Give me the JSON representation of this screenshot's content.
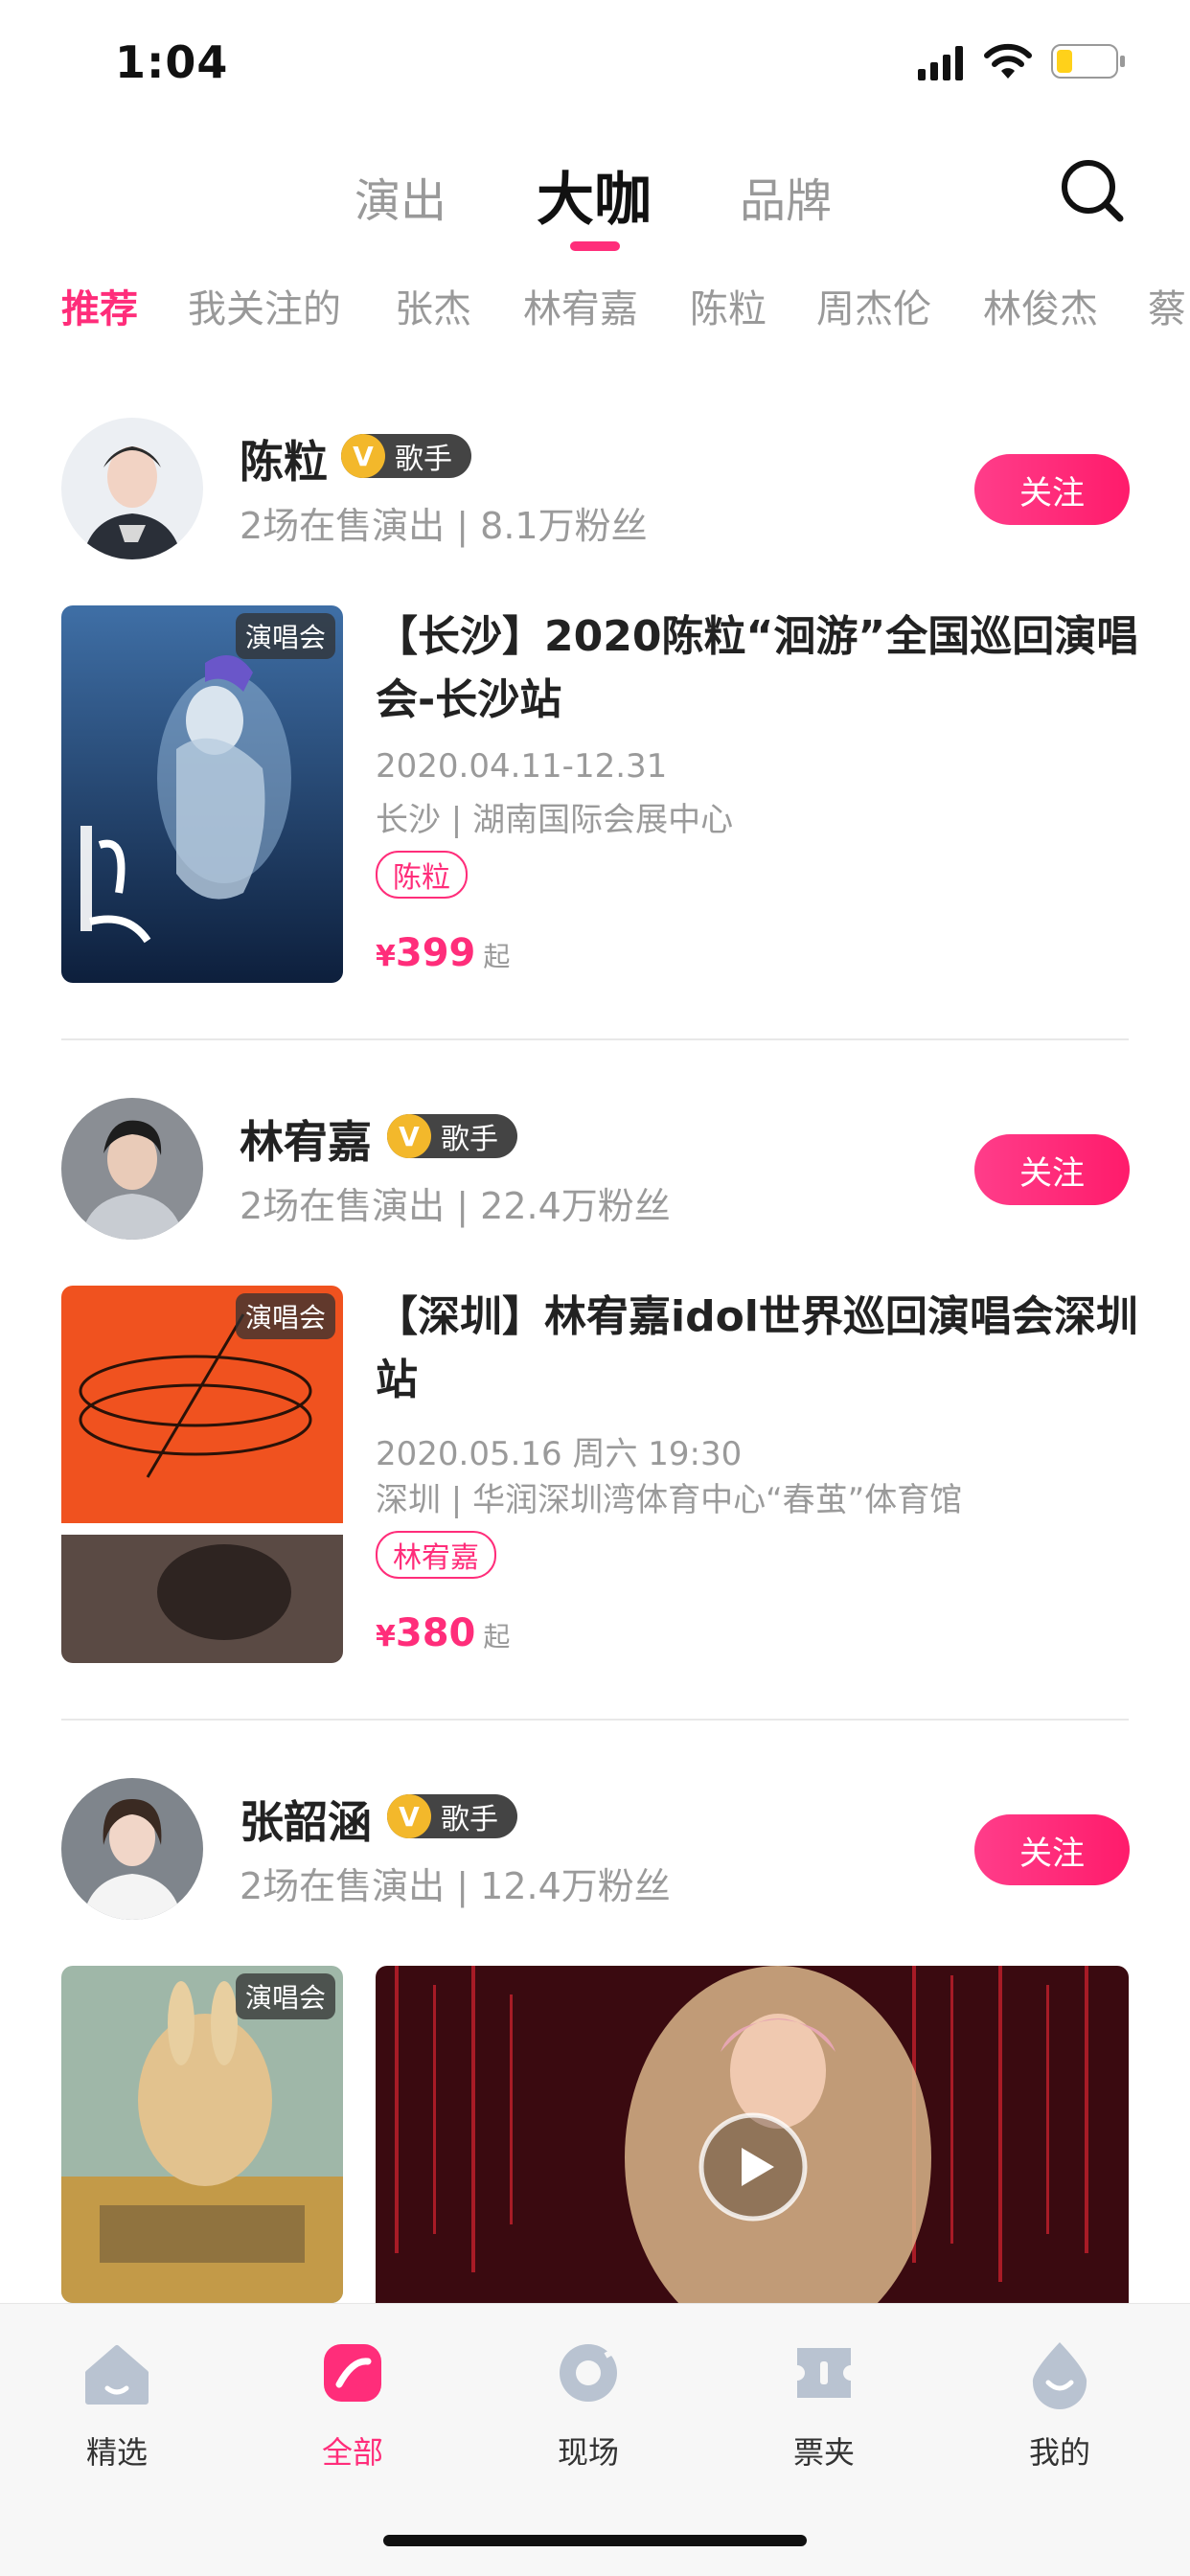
{
  "status_bar": {
    "time": "1:04"
  },
  "top_tabs": [
    {
      "label": "演出"
    },
    {
      "label": "大咖"
    },
    {
      "label": "品牌"
    }
  ],
  "categories": [
    "推荐",
    "我关注的",
    "张杰",
    "林宥嘉",
    "陈粒",
    "周杰伦",
    "林俊杰",
    "蔡"
  ],
  "cards": [
    {
      "name": "陈粒",
      "role": "歌手",
      "meta": "2场在售演出 | 8.1万粉丝",
      "follow_label": "关注",
      "poster_tag": "演唱会",
      "event_title": "【长沙】2020陈粒“洄游”全国巡回演唱会-长沙站",
      "event_date": "2020.04.11-12.31",
      "event_venue": "长沙 | 湖南国际会展中心",
      "event_tag": "陈粒",
      "price_symbol": "¥",
      "price": "399",
      "price_suffix": "起"
    },
    {
      "name": "林宥嘉",
      "role": "歌手",
      "meta": "2场在售演出 | 22.4万粉丝",
      "follow_label": "关注",
      "poster_tag": "演唱会",
      "event_title": "【深圳】林宥嘉idol世界巡回演唱会深圳站",
      "event_date": "2020.05.16 周六 19:30",
      "event_venue": "深圳 | 华润深圳湾体育中心“春茧”体育馆",
      "event_tag": "林宥嘉",
      "price_symbol": "¥",
      "price": "380",
      "price_suffix": "起"
    },
    {
      "name": "张韶涵",
      "role": "歌手",
      "meta": "2场在售演出 | 12.4万粉丝",
      "follow_label": "关注",
      "poster_tag": "演唱会"
    }
  ],
  "badge_letter": "V",
  "bottom_nav": [
    {
      "label": "精选",
      "icon": "home-icon"
    },
    {
      "label": "全部",
      "icon": "all-icon"
    },
    {
      "label": "现场",
      "icon": "live-icon"
    },
    {
      "label": "票夹",
      "icon": "ticket-icon"
    },
    {
      "label": "我的",
      "icon": "profile-icon"
    }
  ],
  "colors": {
    "accent": "#ff2d7a",
    "badge_gold": "#f3b82b"
  }
}
